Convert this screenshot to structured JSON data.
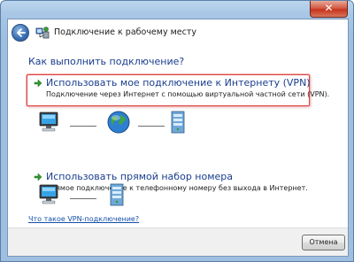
{
  "window": {
    "title": "Подключение к рабочему месту",
    "close_symbol": "✕"
  },
  "main": {
    "question": "Как выполнить подключение?",
    "options": [
      {
        "title": "Использовать мое подключение к Интернету (VPN)",
        "description": "Подключение через Интернет с помощью виртуальной частной сети (VPN).",
        "selected": true
      },
      {
        "title": "Использовать прямой набор номера",
        "description": "Прямое подключение к телефонному номеру без выхода в Интернет.",
        "selected": false
      }
    ],
    "help_link": "Что такое VPN-подключение?"
  },
  "footer": {
    "cancel_label": "Отмена"
  },
  "colors": {
    "accent_text": "#1a3d8f",
    "highlight_border": "#dd4444",
    "arrow": "#2e9a2e"
  },
  "icons": [
    "back-arrow-icon",
    "network-connection-icon",
    "green-arrow-icon",
    "computer-icon",
    "globe-icon",
    "server-icon",
    "close-icon"
  ]
}
